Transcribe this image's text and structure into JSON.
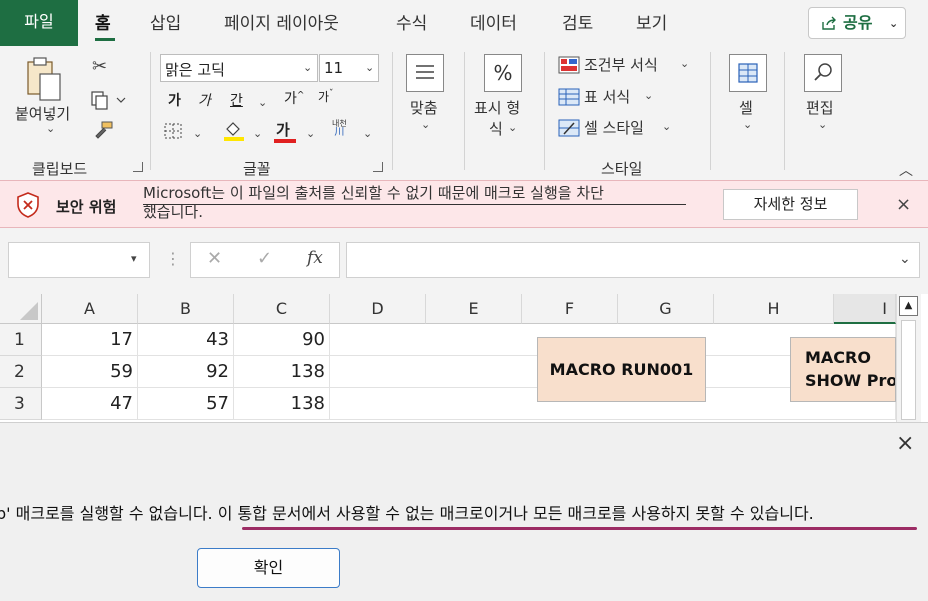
{
  "tabs": [
    "파일",
    "홈",
    "삽입",
    "페이지 레이아웃",
    "수식",
    "데이터",
    "검토",
    "보기"
  ],
  "share": {
    "label": "공유"
  },
  "ribbon": {
    "clipboard": {
      "paste_label": "붙여넣기",
      "group_label": "클립보드"
    },
    "font": {
      "font_name": "맑은 고딕",
      "font_size": "11",
      "bold": "가",
      "italic": "가",
      "underline": "간",
      "grow": "가",
      "shrink": "가",
      "font_color": "가",
      "phonetic_top": "내천",
      "phonetic_bottom": "川",
      "group_label": "글꼴"
    },
    "alignment": {
      "label": "맞춤"
    },
    "number": {
      "label_line1": "표시 형",
      "label_line2": "식"
    },
    "styles": {
      "conditional": "조건부 서식",
      "table": "표 서식",
      "cell_style": "셀 스타일",
      "group_label": "스타일"
    },
    "cells": {
      "label": "셀"
    },
    "editing": {
      "label": "편집"
    }
  },
  "security": {
    "title": "보안 위험",
    "message_line1": "Microsoft는 이 파일의 출처를 신뢰할 수 없기 때문에 매크로 실행을 차단",
    "message_line2": "했습니다.",
    "details_button": "자세한 정보",
    "close": "×"
  },
  "formula_bar": {
    "fx": "fx",
    "cancel": "✕",
    "enter": "✓"
  },
  "columns": [
    "A",
    "B",
    "C",
    "D",
    "E",
    "F",
    "G",
    "H",
    "I"
  ],
  "rows": [
    {
      "num": "1",
      "a": "17",
      "b": "43",
      "c": "90"
    },
    {
      "num": "2",
      "a": "59",
      "b": "92",
      "c": "138"
    },
    {
      "num": "3",
      "a": "47",
      "b": "57",
      "c": "138"
    }
  ],
  "shapes": {
    "run": "MACRO RUN001",
    "show_line1": "MACRO",
    "show_line2": "SHOW Prog"
  },
  "dialog": {
    "message_part1": "p' 매크로를 실행할 수 없습니다. ",
    "message_part2": "이 통합 문서에서 사용할 수 없는 매크로이거나 모든 매크로를 사용하지 못할 수 있습니다.",
    "ok": "확인",
    "close": "×"
  },
  "colors": {
    "excel_green": "#1e6e42",
    "security_bg": "#fde7e9",
    "shape_fill": "#f8dfcc",
    "underline_accent": "#9c2c64"
  }
}
